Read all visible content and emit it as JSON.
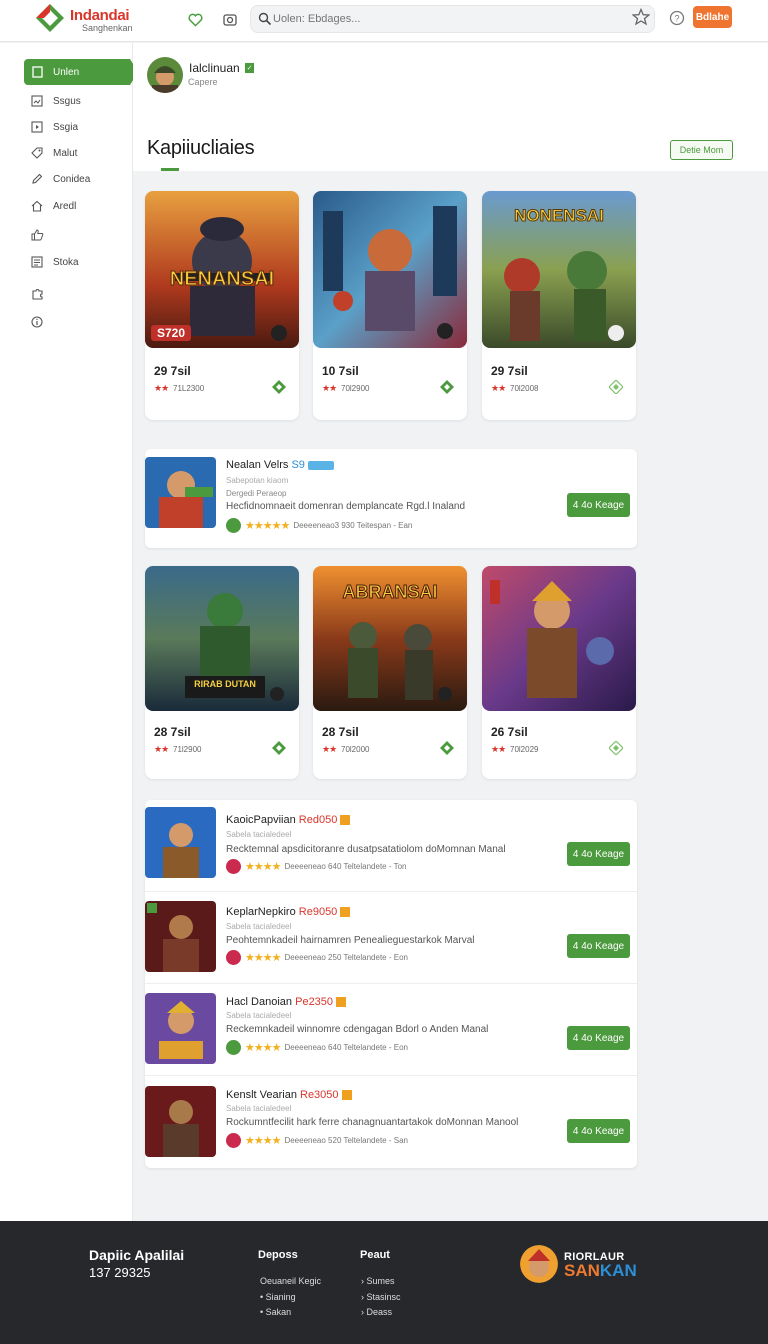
{
  "header": {
    "brand": "Indandai",
    "brand_sub": "Sanghenkan",
    "search_placeholder": "Uolen: Ebdages...",
    "signup_label": "Bdlahe"
  },
  "sidebar": {
    "items": [
      {
        "label": "Unlen",
        "icon": "square-icon",
        "active": true
      },
      {
        "label": "Ssgus",
        "icon": "image-icon"
      },
      {
        "label": "Ssgia",
        "icon": "play-icon"
      },
      {
        "label": "Malut",
        "icon": "tag-icon"
      },
      {
        "label": "Conidea",
        "icon": "pencil-icon"
      },
      {
        "label": "Aredl",
        "icon": "home-icon"
      },
      {
        "label": "",
        "icon": "thumbs-up-icon"
      },
      {
        "label": "Stoka",
        "icon": "list-icon"
      },
      {
        "label": "",
        "icon": "puzzle-icon"
      },
      {
        "label": "",
        "icon": "info-icon"
      }
    ]
  },
  "profile": {
    "name": "Ialclinuan",
    "sub": "Capere"
  },
  "section": {
    "title": "Kapiiucliaies",
    "view_more": "Detie Mom"
  },
  "cards_row1": [
    {
      "price": "29 7sil",
      "count": "71L2300",
      "title_art": "NENANSAI",
      "badge": "S720"
    },
    {
      "price": "10 7sil",
      "count": "70l2900",
      "title_art": ""
    },
    {
      "price": "29 7sil",
      "count": "70l2008",
      "title_art": "NONENSAI"
    }
  ],
  "featured": {
    "title": "Nealan Velrs",
    "title_suffix": "S9",
    "sub1": "Sabepotan kiaom",
    "sub2": "Dergedi Peraeop",
    "desc": "Hecfidnomnaeit domenran demplancate Rgd.l Inaland",
    "meta": "Deeeeneao3 930 Teitespan - Ean",
    "button": "4 4o Keage"
  },
  "cards_row2": [
    {
      "price": "28 7sil",
      "count": "71l2900",
      "title_art": "RIRAB DUTAN"
    },
    {
      "price": "28 7sil",
      "count": "70l2000",
      "title_art": "ABRANSAI"
    },
    {
      "price": "26 7sil",
      "count": "70l2029",
      "title_art": ""
    }
  ],
  "list": [
    {
      "name": "KaoicPapviian",
      "price": "Red050",
      "sub": "Sabela tacialedeel",
      "desc": "Recktemnal apsdicitoranre dusatpsatatiolom doMomnan Manal",
      "meta": "Deeeeneao 640 Teltelandete - Ton",
      "button": "4 4o Keage",
      "badge": "red"
    },
    {
      "name": "KeplarNepkiro",
      "price": "Re9050",
      "sub": "Sabela tacialedeel",
      "desc": "Peohtemnkadeil hairnamren Penealieguestarkok Marval",
      "meta": "Deeeeneao 250 Teltelandete - Eon",
      "button": "4 4o Keage",
      "badge": "red"
    },
    {
      "name": "Hacl Danoian",
      "price": "Pe2350",
      "sub": "Sabela tacialedeel",
      "desc": "Reckemnkadeil winnomre cdengagan Bdorl o Anden Manal",
      "meta": "Deeeeneao 640 Teltelandete - Eon",
      "button": "4 4o Keage",
      "badge": "green"
    },
    {
      "name": "Kenslt Vearian",
      "price": "Re3050",
      "sub": "Sabela tacialedeel",
      "desc": "Rockumntfecilit hark ferre chanagnuantartakok doMonnan Manool",
      "meta": "Deeeeneao 520 Teltelandete - San",
      "button": "4 4o Keage",
      "badge": "red"
    }
  ],
  "footer": {
    "title": "Dapiic Apalilai",
    "number": "137 29325",
    "col1_heading": "Deposs",
    "col1_links": [
      "Oeuaneil Kegic",
      "Sianing",
      "Sakan"
    ],
    "col2_heading": "Peaut",
    "col2_links": [
      "Sumes",
      "Stasinsc",
      "Deass"
    ],
    "brand_top": "RIORLAUR",
    "brand_bottom_a": "SAN",
    "brand_bottom_b": "KAN"
  },
  "colors": {
    "accent": "#4c9a3e",
    "orange": "#ee7430",
    "price_red": "#d9352b",
    "star_gold": "#f2b01e"
  }
}
